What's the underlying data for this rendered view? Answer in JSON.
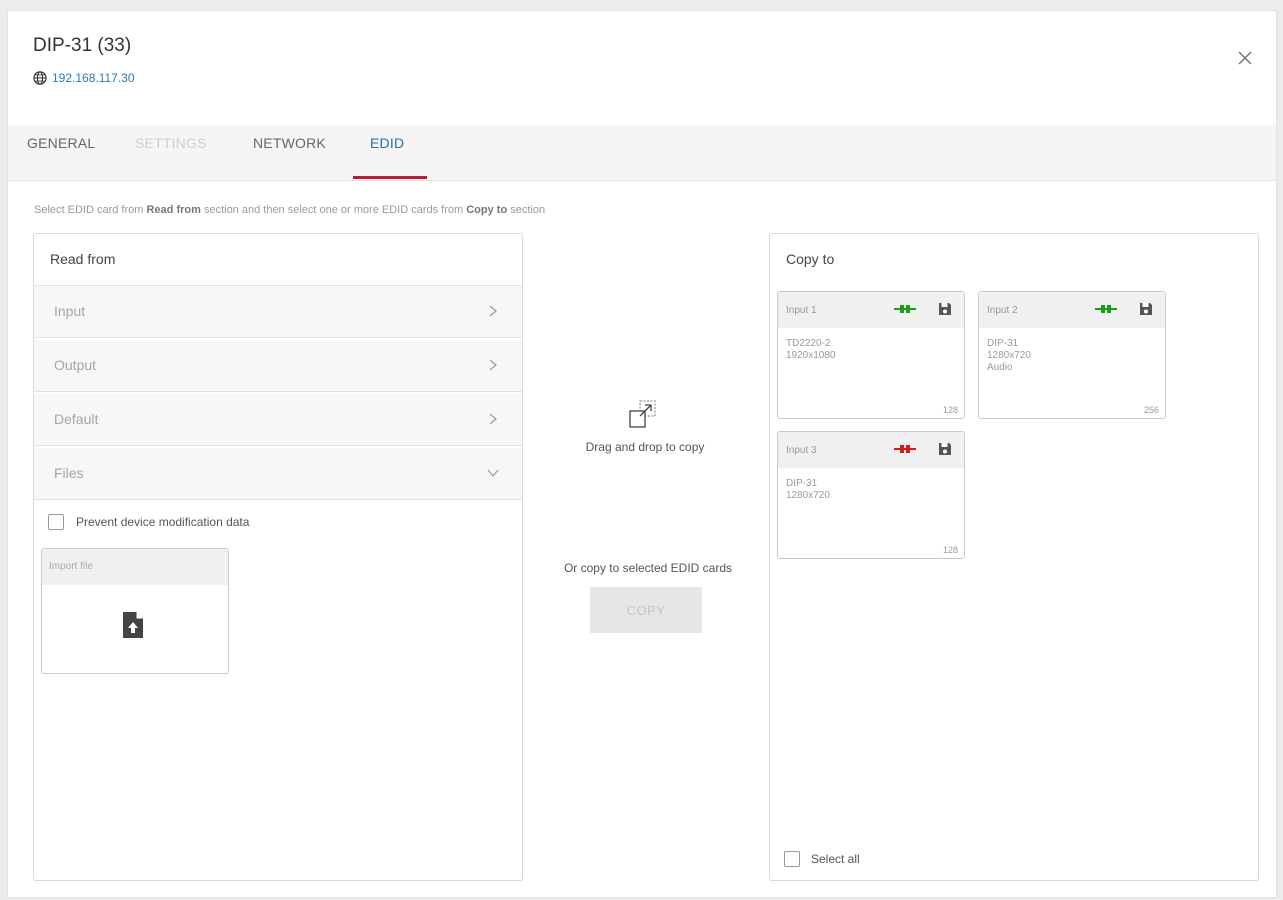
{
  "dialog": {
    "title": "DIP-31 (33)",
    "ip": "192.168.117.30"
  },
  "tabs": [
    {
      "label": "GENERAL",
      "state": "normal"
    },
    {
      "label": "SETTINGS",
      "state": "disabled"
    },
    {
      "label": "NETWORK",
      "state": "normal"
    },
    {
      "label": "EDID",
      "state": "active"
    }
  ],
  "hint": {
    "part1": "Select EDID card from ",
    "bold1": "Read from",
    "part2": " section and then select one or more EDID cards from ",
    "bold2": "Copy to",
    "part3": " section"
  },
  "read_from": {
    "title": "Read from",
    "sections": [
      {
        "label": "Input",
        "expanded": false
      },
      {
        "label": "Output",
        "expanded": false
      },
      {
        "label": "Default",
        "expanded": false
      },
      {
        "label": "Files",
        "expanded": true
      }
    ],
    "prevent_label": "Prevent device modification data",
    "import_label": "Import file"
  },
  "middle": {
    "drag_text": "Drag and drop to copy",
    "or_text": "Or copy to selected EDID cards",
    "copy_label": "COPY"
  },
  "copy_to": {
    "title": "Copy to",
    "cards": [
      {
        "title": "Input 1",
        "status_color": "#1a9e1a",
        "line1": "TD2220-2",
        "line2": "1920x1080",
        "line3": "",
        "size": "128"
      },
      {
        "title": "Input 2",
        "status_color": "#1a9e1a",
        "line1": "DIP-31",
        "line2": "1280x720",
        "line3": "Audio",
        "size": "256"
      },
      {
        "title": "Input 3",
        "status_color": "#d61a1a",
        "line1": "DIP-31",
        "line2": "1280x720",
        "line3": "",
        "size": "128"
      }
    ],
    "select_all_label": "Select all"
  },
  "colors": {
    "accent_link": "#2a7bbd",
    "tab_underline": "#b91c3a",
    "connected": "#1a9e1a",
    "disconnected": "#d61a1a"
  }
}
